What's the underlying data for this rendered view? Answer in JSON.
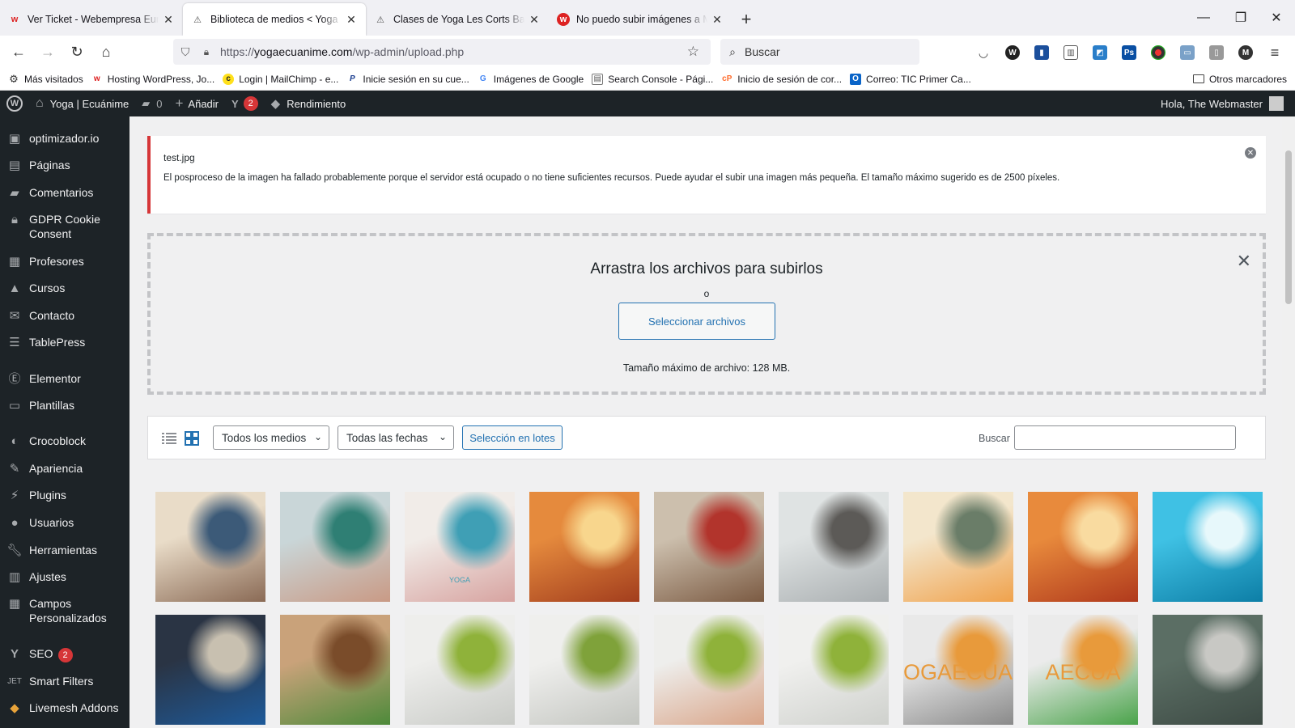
{
  "browser": {
    "tabs": [
      {
        "title": "Ver Ticket - Webempresa Europa",
        "favicon": "webempresa-icon"
      },
      {
        "title": "Biblioteca de medios < Yoga | Ecuánime",
        "favicon": "warning-icon"
      },
      {
        "title": "Clases de Yoga Les Corts Barcelona",
        "favicon": "warning-icon"
      },
      {
        "title": "No puedo subir imágenes a Media",
        "favicon": "webempresa-icon"
      }
    ],
    "new_tab": "+",
    "url": {
      "scheme": "https://",
      "host": "yogaecuanime.com",
      "path": "/wp-admin/upload.php"
    },
    "search_placeholder": "Buscar",
    "bookmarks": [
      {
        "label": "Más visitados",
        "icon": "gear-icon"
      },
      {
        "label": "Hosting WordPress, Jo...",
        "icon": "webempresa-icon"
      },
      {
        "label": "Login | MailChimp - e...",
        "icon": "mailchimp-icon"
      },
      {
        "label": "Inicie sesión en su cue...",
        "icon": "paypal-icon"
      },
      {
        "label": "Imágenes de Google",
        "icon": "google-icon"
      },
      {
        "label": "Search Console - Pági...",
        "icon": "search-console-icon"
      },
      {
        "label": "Inicio de sesión de cor...",
        "icon": "cpanel-icon"
      },
      {
        "label": "Correo: TIC Primer Ca...",
        "icon": "outlook-icon"
      }
    ],
    "other_bookmarks": "Otros marcadores"
  },
  "adminbar": {
    "site_name": "Yoga | Ecuánime",
    "comments_count": "0",
    "add_new": "Añadir",
    "yoast_count": "2",
    "performance": "Rendimiento",
    "greeting": "Hola, The Webmaster"
  },
  "sidebar": {
    "items": [
      {
        "label": "optimizador.io",
        "icon": "optimizer-icon"
      },
      {
        "label": "Páginas",
        "icon": "pages-icon"
      },
      {
        "label": "Comentarios",
        "icon": "comments-icon"
      },
      {
        "label": "GDPR Cookie Consent",
        "icon": "lock-icon"
      },
      {
        "label": "Profesores",
        "icon": "profile-card-icon"
      },
      {
        "label": "Cursos",
        "icon": "graduation-cap-icon"
      },
      {
        "label": "Contacto",
        "icon": "envelope-icon"
      },
      {
        "label": "TablePress",
        "icon": "table-icon"
      },
      {
        "label": "Elementor",
        "icon": "elementor-icon"
      },
      {
        "label": "Plantillas",
        "icon": "folder-icon"
      },
      {
        "label": "Crocoblock",
        "icon": "crocoblock-icon"
      },
      {
        "label": "Apariencia",
        "icon": "brush-icon"
      },
      {
        "label": "Plugins",
        "icon": "plugin-icon"
      },
      {
        "label": "Usuarios",
        "icon": "user-icon"
      },
      {
        "label": "Herramientas",
        "icon": "wrench-icon"
      },
      {
        "label": "Ajustes",
        "icon": "settings-icon"
      },
      {
        "label": "Campos Personalizados",
        "icon": "fields-icon"
      },
      {
        "label": "SEO",
        "icon": "yoast-icon",
        "badge": "2"
      },
      {
        "label": "Smart Filters",
        "icon": "jet-icon"
      },
      {
        "label": "Livemesh Addons",
        "icon": "livemesh-icon"
      }
    ]
  },
  "notice": {
    "filename": "test.jpg",
    "message": "El posproceso de la imagen ha fallado probablemente porque el servidor está ocupado o no tiene suficientes recursos. Puede ayudar el subir una imagen más pequeña. El tamaño máximo sugerido es de 2500 píxeles."
  },
  "uploader": {
    "heading": "Arrastra los archivos para subirlos",
    "or": "o",
    "select_button": "Seleccionar archivos",
    "max_size": "Tamaño máximo de archivo: 128 MB."
  },
  "media_toolbar": {
    "filter_type": "Todos los medios",
    "filter_date": "Todas las fechas",
    "bulk_select": "Selección en lotes",
    "search_label": "Buscar",
    "search_value": ""
  },
  "media_grid": {
    "rows": [
      [
        {
          "name": "mother-child-photo",
          "colors": [
            "#e9dcc8",
            "#8a6a55",
            "#3c5a78"
          ]
        },
        {
          "name": "woman-smoothie-photo",
          "colors": [
            "#c9d6d8",
            "#c99a85",
            "#2f7f74"
          ]
        },
        {
          "name": "smoothies-photo",
          "colors": [
            "#f1ece8",
            "#d7a3a0",
            "#3f9fb5"
          ],
          "text": "YOGA"
        },
        {
          "name": "autumn-walk-photo",
          "colors": [
            "#e58a3d",
            "#a23d1d",
            "#f8d68d"
          ]
        },
        {
          "name": "women-laughing-photo",
          "colors": [
            "#ccbfad",
            "#7b5a42",
            "#b2342c"
          ]
        },
        {
          "name": "window-reflection-photo",
          "colors": [
            "#dfe3e3",
            "#a9aeb0",
            "#5c5a57"
          ]
        },
        {
          "name": "sunset-dancer-photo",
          "colors": [
            "#f3e6cc",
            "#f0a24c",
            "#6a7d68"
          ]
        },
        {
          "name": "autumn-path-photo",
          "colors": [
            "#e88a3c",
            "#b0391c",
            "#f9dba0"
          ]
        },
        {
          "name": "swimmer-photo",
          "colors": [
            "#3fc1e4",
            "#0d7ea6",
            "#e7f8fb"
          ]
        }
      ],
      [
        {
          "name": "cyclists-photo",
          "colors": [
            "#2a3444",
            "#1e5a9a",
            "#c8c0b0"
          ]
        },
        {
          "name": "vegetables-photo",
          "colors": [
            "#c9a27a",
            "#4d8a3a",
            "#7a4c2a"
          ]
        },
        {
          "name": "yoga-room-photo",
          "colors": [
            "#eeeeec",
            "#c9cbc7",
            "#8fb23a"
          ]
        },
        {
          "name": "yoga-room-plant-photo",
          "colors": [
            "#efefed",
            "#c3c5c0",
            "#7fa23a"
          ]
        },
        {
          "name": "yoga-class-photo",
          "colors": [
            "#eeeeec",
            "#d9a589",
            "#8fb23a"
          ]
        },
        {
          "name": "yoga-room-2-photo",
          "colors": [
            "#f0f0ee",
            "#cfd1cd",
            "#8fb23a"
          ]
        },
        {
          "name": "logo-yogaecuanime-1",
          "colors": [
            "#e9e9e9",
            "#8a8a8a",
            "#e89a3b"
          ],
          "text": "OGAECUAN"
        },
        {
          "name": "logo-yogaecuanime-2",
          "colors": [
            "#ebebeb",
            "#4aa34a",
            "#e89a3b"
          ],
          "text": "AECUA"
        },
        {
          "name": "laptop-legs-photo",
          "colors": [
            "#5b6e64",
            "#3d4a44",
            "#c8c8c4"
          ]
        }
      ]
    ]
  },
  "colors": {
    "admin_bar": "#1d2327",
    "accent": "#2271b1",
    "error": "#d63638",
    "badge": "#d63638"
  }
}
